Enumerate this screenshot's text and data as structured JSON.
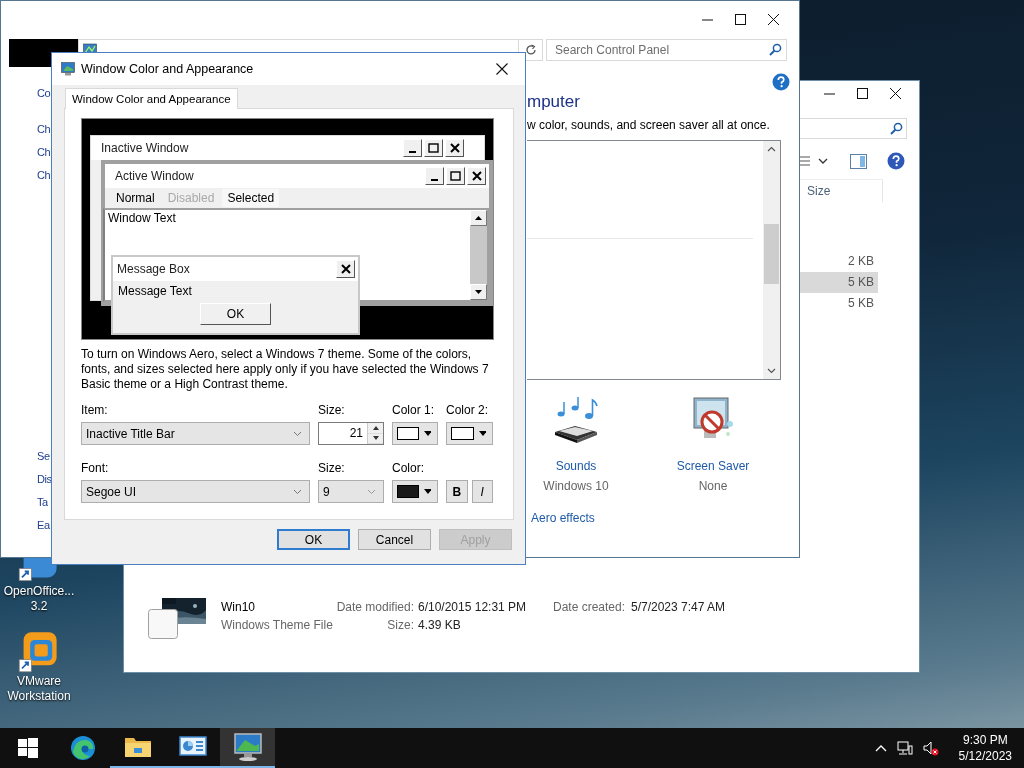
{
  "desktop_icons": [
    {
      "kind": "openoffice",
      "lines": [
        "OpenOffice...",
        "3.2"
      ]
    },
    {
      "kind": "vmware",
      "lines": [
        "VMware",
        "Workstation"
      ]
    }
  ],
  "explorer": {
    "column_header": "Size",
    "rows": [
      {
        "size": "2 KB",
        "selected": false
      },
      {
        "size": "5 KB",
        "selected": true
      },
      {
        "size": "5 KB",
        "selected": false
      }
    ],
    "details": {
      "name": "Win10",
      "type": "Windows Theme File",
      "date_modified_label": "Date modified:",
      "date_modified": "6/10/2015 12:31 PM",
      "size_label": "Size:",
      "size": "4.39 KB",
      "date_created_label": "Date created:",
      "date_created": "5/7/2023 7:47 AM"
    }
  },
  "control_panel": {
    "search_placeholder": "Search Control Panel",
    "sidebar_top": [
      "Co",
      "Ch",
      "Ch",
      "Ch"
    ],
    "sidebar_bottom": [
      "Se",
      "Dis",
      "Ta",
      "Ea"
    ],
    "heading": "mputer",
    "description": "w color, sounds, and screen saver all at once.",
    "settings": [
      {
        "kind": "sounds",
        "label": "Sounds",
        "value": "Windows 10"
      },
      {
        "kind": "screensaver",
        "label": "Screen Saver",
        "value": "None"
      }
    ],
    "link": "Aero effects"
  },
  "dialog": {
    "title": "Window Color and Appearance",
    "tabs": [
      {
        "label": "Window Color and Appearance",
        "selected": true
      }
    ],
    "preview": {
      "inactive_title": "Inactive Window",
      "active_title": "Active Window",
      "menu": [
        {
          "label": "Normal",
          "kind": "normal"
        },
        {
          "label": "Disabled",
          "kind": "disabled"
        },
        {
          "label": "Selected",
          "kind": "selected"
        }
      ],
      "window_text": "Window Text",
      "message_title": "Message Box",
      "message_text": "Message Text",
      "ok": "OK"
    },
    "info": "To turn on Windows Aero, select a Windows 7 theme.  Some of the colors, fonts, and sizes selected here apply only if you have selected the Windows 7 Basic theme or a High Contrast theme.",
    "item_label": "Item:",
    "item_value": "Inactive Title Bar",
    "size_label": "Size:",
    "size_value": "21",
    "color_pickers": [
      {
        "label": "Color 1:",
        "color": "#ffffff"
      },
      {
        "label": "Color 2:",
        "color": "#ffffff"
      }
    ],
    "font_label": "Font:",
    "font_value": "Segoe UI",
    "font_size_label": "Size:",
    "font_size": "9",
    "font_color": {
      "label": "Color:",
      "color": "#1a1a1a"
    },
    "bold_label": "B",
    "italic_label": "I",
    "buttons": [
      {
        "label": "OK",
        "default": true,
        "disabled": false
      },
      {
        "label": "Cancel",
        "default": false,
        "disabled": false
      },
      {
        "label": "Apply",
        "default": false,
        "disabled": true
      }
    ]
  },
  "taskbar": {
    "apps": [
      {
        "kind": "start",
        "running": false,
        "active": false
      },
      {
        "kind": "edge",
        "running": false,
        "active": false
      },
      {
        "kind": "folder",
        "running": true,
        "active": false
      },
      {
        "kind": "control-panel",
        "running": true,
        "active": false
      },
      {
        "kind": "display",
        "running": true,
        "active": true
      }
    ],
    "time": "9:30 PM",
    "date": "5/12/2023"
  }
}
